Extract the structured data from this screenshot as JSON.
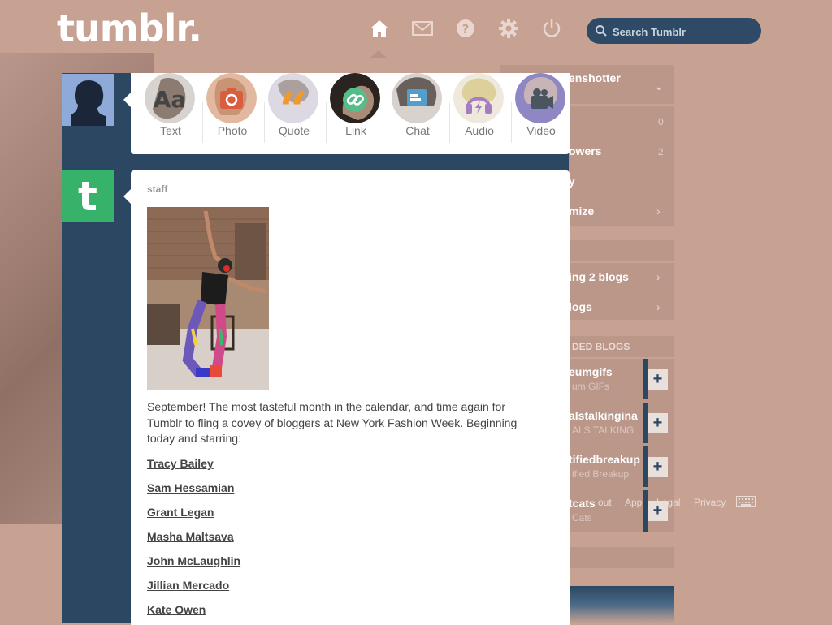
{
  "header": {
    "logo": "tumblr.",
    "nav_icons": [
      "home-icon",
      "mail-icon",
      "help-icon",
      "gear-icon",
      "power-icon"
    ],
    "search": {
      "placeholder": "Search Tumblr",
      "value": ""
    }
  },
  "composer": {
    "post_types": [
      {
        "label": "Text",
        "icon": "text-post-icon",
        "color": "#444444",
        "glyph": "Aa"
      },
      {
        "label": "Photo",
        "icon": "photo-post-icon",
        "color": "#d95e40"
      },
      {
        "label": "Quote",
        "icon": "quote-post-icon",
        "color": "#f2992e",
        "glyph": "“"
      },
      {
        "label": "Link",
        "icon": "link-post-icon",
        "color": "#56bc8a"
      },
      {
        "label": "Chat",
        "icon": "chat-post-icon",
        "color": "#529ecc"
      },
      {
        "label": "Audio",
        "icon": "audio-post-icon",
        "color": "#a77dc2"
      },
      {
        "label": "Video",
        "icon": "video-post-icon",
        "color": "#748089"
      }
    ]
  },
  "post": {
    "author": "staff",
    "body": "September! The most tasteful month in the calendar, and time again for Tumblr to fling a covey of bloggers at New York Fashion Week. Beginning today and starring:",
    "links": [
      "Tracy Bailey",
      "Sam Hessamian",
      "Grant Legan",
      "Masha Maltsava",
      "John McLaughlin",
      "Jillian Mercado",
      "Kate Owen"
    ]
  },
  "sidebar": {
    "blog_name": "enshotter",
    "stats": [
      {
        "label": "",
        "count": "0"
      },
      {
        "label": "owers",
        "count": "2"
      },
      {
        "label": "y",
        "count": ""
      },
      {
        "label": "mize",
        "count": ""
      }
    ],
    "following": "ing 2 blogs",
    "find_blogs": "logs",
    "recommended_heading": "DED BLOGS",
    "recommended": [
      {
        "name": "eumgifs",
        "sub": "um GIFs"
      },
      {
        "name": "alstalkingina",
        "sub": "ALS TALKING"
      },
      {
        "name": "tifiedbreakup",
        "sub": "ified Breakup"
      },
      {
        "name": "tcats",
        "sub": "Cats"
      }
    ],
    "footer": [
      "out",
      "App",
      "Legal",
      "Privacy"
    ],
    "colors": {
      "accent": "#2c4762",
      "panel": "#bb978a",
      "background": "#c7a293"
    }
  }
}
